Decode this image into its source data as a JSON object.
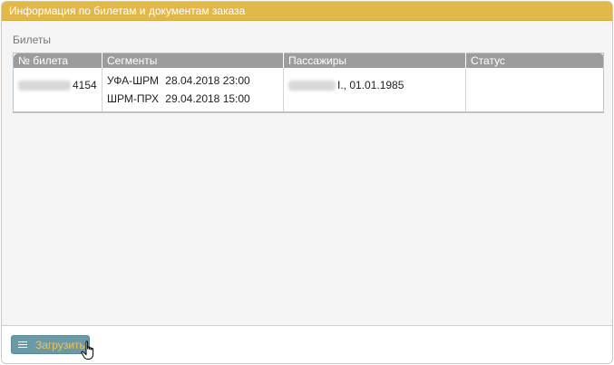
{
  "panel": {
    "title": "Информация по билетам и документам заказа"
  },
  "tickets_section": {
    "title": "Билеты",
    "columns": [
      "№ билета",
      "Сегменты",
      "Пассажиры",
      "Статус"
    ],
    "rows": [
      {
        "ticket_suffix": "4154",
        "segments": [
          {
            "route": "УФА-ШРМ",
            "datetime": "28.04.2018 23:00"
          },
          {
            "route": "ШРМ-ПРХ",
            "datetime": "29.04.2018 15:00"
          }
        ],
        "passenger_suffix": "I., 01.01.1985",
        "status": ""
      }
    ]
  },
  "footer": {
    "load_button_label": "Загрузить",
    "load_button_icon": "menu-icon"
  },
  "colors": {
    "header": "#e2b84a",
    "table_header": "#9c9c9c",
    "button": "#6a9aa5",
    "button_text": "#f0c35a"
  }
}
